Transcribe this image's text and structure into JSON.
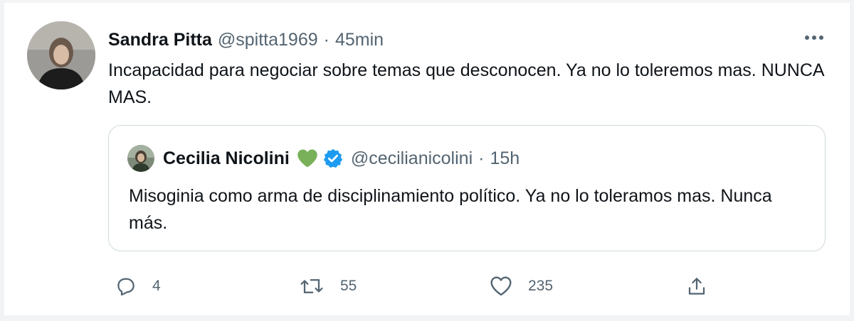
{
  "tweet": {
    "author": {
      "name": "Sandra Pitta",
      "handle": "@spitta1969",
      "separator": "·",
      "time": "45min"
    },
    "text": "Incapacidad para negociar sobre temas que desconocen. Ya no lo toleremos mas. NUNCA MAS.",
    "quoted": {
      "author": {
        "name": "Cecilia Nicolini",
        "handle": "@cecilianicolini",
        "separator": "·",
        "time": "15h"
      },
      "text": "Misoginia como arma de disciplinamiento político. Ya no lo toleramos mas. Nunca más."
    },
    "actions": {
      "replies": "4",
      "retweets": "55",
      "likes": "235"
    }
  },
  "icons": {
    "more": "more-horizontal-icon",
    "reply": "reply-icon",
    "retweet": "retweet-icon",
    "like": "heart-icon",
    "share": "share-icon",
    "name_emoji": "green-heart-icon",
    "verified": "verified-badge-icon"
  },
  "colors": {
    "text_primary": "#0f1419",
    "text_secondary": "#536471",
    "border": "#cfd9de",
    "verified_blue": "#1d9bf0",
    "green_heart": "#78b159",
    "background": "#ffffff"
  }
}
